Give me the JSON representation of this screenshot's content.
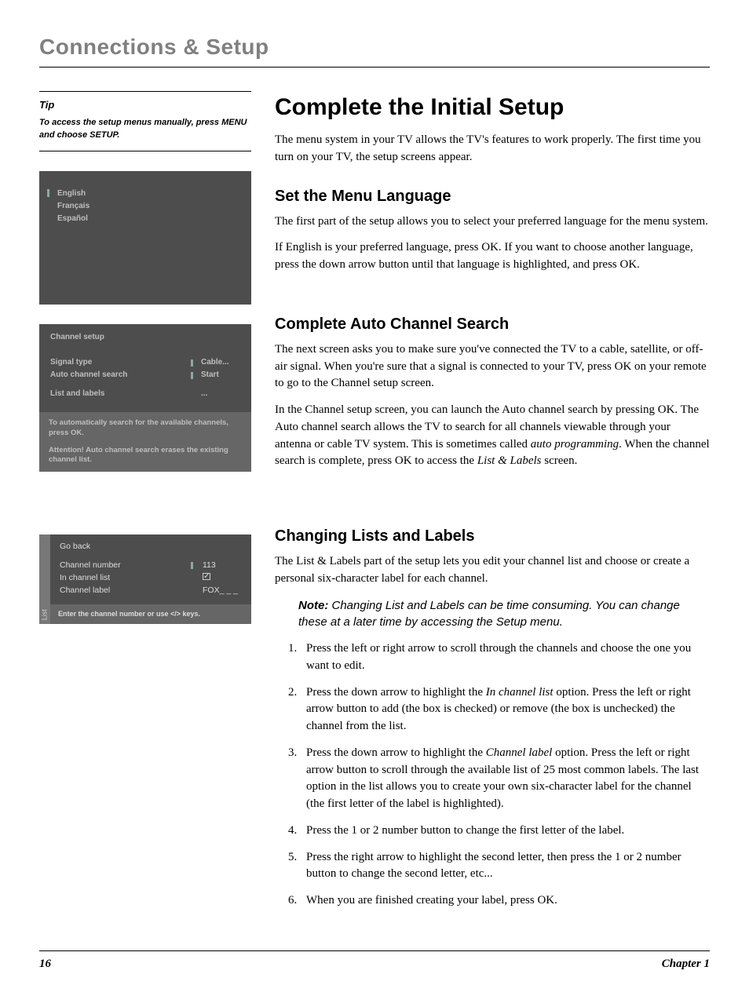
{
  "header": {
    "title": "Connections & Setup"
  },
  "tip": {
    "label": "Tip",
    "text": "To access the setup menus manually, press MENU and choose SETUP."
  },
  "langScreen": {
    "options": [
      "English",
      "Français",
      "Español"
    ]
  },
  "setupScreen": {
    "title": "Channel setup",
    "rows": [
      {
        "label": "Signal type",
        "value": "Cable..."
      },
      {
        "label": "Auto channel search",
        "value": "Start"
      },
      {
        "label": "List and labels",
        "value": "..."
      }
    ],
    "help1": "To automatically search for the available channels, press OK.",
    "help2": "Attention! Auto channel search erases the existing channel list."
  },
  "listScreen": {
    "tab": "List",
    "goback": "Go back",
    "rows": [
      {
        "label": "Channel number",
        "value": "113"
      },
      {
        "label": "In channel list",
        "value": "check"
      },
      {
        "label": "Channel label",
        "value": "FOX_ _ _"
      }
    ],
    "help": "Enter the channel number or use </> keys."
  },
  "main": {
    "h1": "Complete the Initial Setup",
    "intro": "The menu system in your TV allows the TV's features to work properly. The first time you turn on your TV, the setup screens appear.",
    "lang": {
      "title": "Set the Menu Language",
      "p1": "The first part of the setup allows you to select your preferred language for the menu system.",
      "p2": "If English is your preferred language, press OK. If you want to choose another language, press the down arrow button until that language is highlighted, and press OK."
    },
    "auto": {
      "title": "Complete Auto Channel Search",
      "p1": "The next screen asks you to make sure you've connected the TV to a cable, satellite, or off-air signal. When you're sure that a signal is connected to your TV, press OK on your remote to go to the Channel setup screen.",
      "p2a": "In the Channel setup screen, you can launch the Auto channel search by pressing OK. The Auto channel search allows the TV to search for all channels viewable through your antenna or cable TV system. This is sometimes called ",
      "p2b": "auto programming",
      "p2c": ". When the channel search is complete, press OK to access the ",
      "p2d": "List & Labels",
      "p2e": " screen."
    },
    "lists": {
      "title": "Changing Lists and Labels",
      "p1": "The List & Labels part of the setup lets you edit your channel list and choose or create a personal six-character label for each channel.",
      "noteLabel": "Note:",
      "noteText": " Changing List and Labels can be time consuming. You can change these at a later time by accessing the Setup menu.",
      "steps": {
        "s1": "Press the left or right arrow to scroll through the channels and choose the one you want to edit.",
        "s2a": "Press the down arrow to highlight the ",
        "s2b": "In channel list",
        "s2c": " option. Press the left or right arrow button to add (the box is checked) or remove (the box is unchecked) the channel from the list.",
        "s3a": "Press the down arrow to highlight the ",
        "s3b": "Channel label",
        "s3c": " option. Press the left or right arrow button to scroll through the available list of 25 most common labels. The last option in the list allows you to create your own six-character label for the channel (the first letter of the label is highlighted).",
        "s4": "Press the 1 or 2 number button to change the first letter of the label.",
        "s5": "Press the right arrow to highlight the second letter, then press the 1 or 2 number button to change the second letter, etc...",
        "s6": "When you are finished creating your label, press OK."
      }
    }
  },
  "footer": {
    "page": "16",
    "chapter": "Chapter 1"
  }
}
